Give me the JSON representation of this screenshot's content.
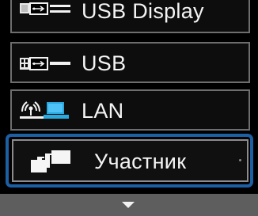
{
  "menu": {
    "items": [
      {
        "label": "USB Display",
        "icon": "usb-connector-icon"
      },
      {
        "label": "USB",
        "icon": "usb-connector-icon"
      },
      {
        "label": "LAN",
        "icon": "network-antenna-icon"
      },
      {
        "label": "Участник",
        "icon": "participant-windows-icon",
        "selected": true
      }
    ]
  },
  "colors": {
    "selection_border": "#1d5fa3",
    "background": "#000000",
    "text": "#f4f4f4",
    "bottom_bar": "#5e5e5e"
  }
}
